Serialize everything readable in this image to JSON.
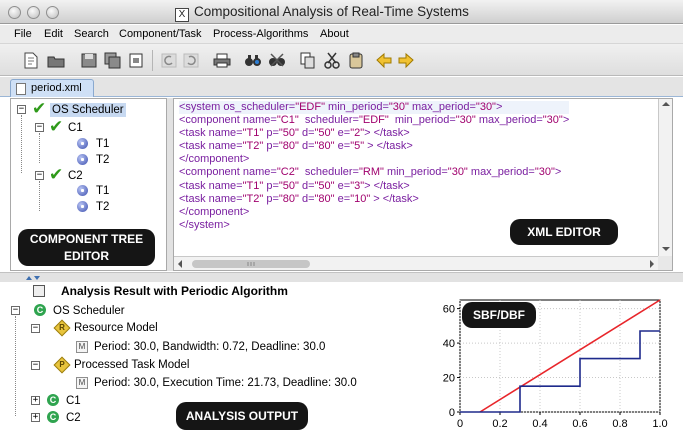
{
  "window": {
    "title": "Compositional Analysis of Real-Time Systems",
    "x_icon_label": "X"
  },
  "menu": [
    "File",
    "Edit",
    "Search",
    "Component/Task",
    "Process-Algorithms",
    "About"
  ],
  "tab": {
    "label": "period.xml"
  },
  "component_tree": {
    "root": "OS Scheduler",
    "components": [
      {
        "name": "C1",
        "tasks": [
          "T1",
          "T2"
        ]
      },
      {
        "name": "C2",
        "tasks": [
          "T1",
          "T2"
        ]
      }
    ]
  },
  "xml_lines": [
    [
      [
        "k",
        "<system "
      ],
      [
        "a",
        "os_scheduler="
      ],
      [
        "v",
        "\"EDF\""
      ],
      [
        "a",
        " min_period="
      ],
      [
        "v",
        "\"30\""
      ],
      [
        "a",
        " max_period="
      ],
      [
        "v",
        "\"30\""
      ],
      [
        "k",
        ">"
      ]
    ],
    [
      [
        "k",
        "<component "
      ],
      [
        "a",
        "name="
      ],
      [
        "v",
        "\"C1\""
      ],
      [
        "a",
        "  scheduler="
      ],
      [
        "v",
        "\"EDF\""
      ],
      [
        "a",
        "  min_period="
      ],
      [
        "v",
        "\"30\""
      ],
      [
        "a",
        " max_period="
      ],
      [
        "v",
        "\"30\""
      ],
      [
        "k",
        ">"
      ]
    ],
    [
      [
        "k",
        "<task "
      ],
      [
        "a",
        "name="
      ],
      [
        "v",
        "\"T1\""
      ],
      [
        "a",
        " p="
      ],
      [
        "v",
        "\"50\""
      ],
      [
        "a",
        " d="
      ],
      [
        "v",
        "\"50\""
      ],
      [
        "a",
        " e="
      ],
      [
        "v",
        "\"2\""
      ],
      [
        "k",
        "> </task>"
      ]
    ],
    [
      [
        "k",
        "<task "
      ],
      [
        "a",
        "name="
      ],
      [
        "v",
        "\"T2\""
      ],
      [
        "a",
        " p="
      ],
      [
        "v",
        "\"80\""
      ],
      [
        "a",
        " d="
      ],
      [
        "v",
        "\"80\""
      ],
      [
        "a",
        " e="
      ],
      [
        "v",
        "\"5\""
      ],
      [
        "k",
        " > </task>"
      ]
    ],
    [
      [
        "k",
        "</component>"
      ]
    ],
    [
      [
        "k",
        "<component "
      ],
      [
        "a",
        "name="
      ],
      [
        "v",
        "\"C2\""
      ],
      [
        "a",
        "  scheduler="
      ],
      [
        "v",
        "\"RM\""
      ],
      [
        "a",
        " min_period="
      ],
      [
        "v",
        "\"30\""
      ],
      [
        "a",
        " max_period="
      ],
      [
        "v",
        "\"30\""
      ],
      [
        "k",
        ">"
      ]
    ],
    [
      [
        "k",
        "<task "
      ],
      [
        "a",
        "name="
      ],
      [
        "v",
        "\"T1\""
      ],
      [
        "a",
        " p="
      ],
      [
        "v",
        "\"50\""
      ],
      [
        "a",
        " d="
      ],
      [
        "v",
        "\"50\""
      ],
      [
        "a",
        " e="
      ],
      [
        "v",
        "\"3\""
      ],
      [
        "k",
        "> </task>"
      ]
    ],
    [
      [
        "k",
        "<task "
      ],
      [
        "a",
        "name="
      ],
      [
        "v",
        "\"T2\""
      ],
      [
        "a",
        " p="
      ],
      [
        "v",
        "\"80\""
      ],
      [
        "a",
        " d="
      ],
      [
        "v",
        "\"80\""
      ],
      [
        "a",
        " e="
      ],
      [
        "v",
        "\"10\""
      ],
      [
        "k",
        " > </task>"
      ]
    ],
    [
      [
        "k",
        "</component>"
      ]
    ],
    [
      [
        "k",
        "</system>"
      ]
    ]
  ],
  "analysis": {
    "header": "Analysis Result with Periodic Algorithm",
    "root": "OS Scheduler",
    "resource_model": {
      "label": "Resource Model",
      "badge": "R",
      "detail": "Period: 30.0, Bandwidth: 0.72, Deadline: 30.0"
    },
    "task_model": {
      "label": "Processed Task Model",
      "badge": "P",
      "detail": "Period: 30.0, Execution Time: 21.73, Deadline: 30.0"
    },
    "components": [
      "C1",
      "C2"
    ],
    "root_badge": "C",
    "detail_badge": "M"
  },
  "callouts": {
    "tree": [
      "COMPONENT TREE",
      "EDITOR"
    ],
    "xml": "XML EDITOR",
    "output": "ANALYSIS OUTPUT",
    "chart": "SBF/DBF"
  },
  "colors": {
    "sbf": "#e8262b",
    "dbf": "#1e2a8c",
    "check": "#2f9a1a"
  },
  "chart_data": {
    "type": "line",
    "title": "",
    "xlabel": "",
    "ylabel": "",
    "xlim": [
      0,
      1.0
    ],
    "ylim": [
      0,
      65
    ],
    "xticks": [
      0,
      0.2,
      0.4,
      0.6,
      0.8,
      1.0
    ],
    "yticks": [
      0,
      20,
      40,
      60
    ],
    "grid": true,
    "series": [
      {
        "color": "#e8262b",
        "points": [
          [
            0.1,
            0
          ],
          [
            1.0,
            65
          ]
        ]
      },
      {
        "color": "#1e2a8c",
        "points": [
          [
            0,
            0
          ],
          [
            0.3,
            0
          ],
          [
            0.3,
            15
          ],
          [
            0.6,
            15
          ],
          [
            0.6,
            31
          ],
          [
            0.9,
            31
          ],
          [
            0.9,
            47
          ],
          [
            1.0,
            47
          ]
        ]
      }
    ]
  }
}
